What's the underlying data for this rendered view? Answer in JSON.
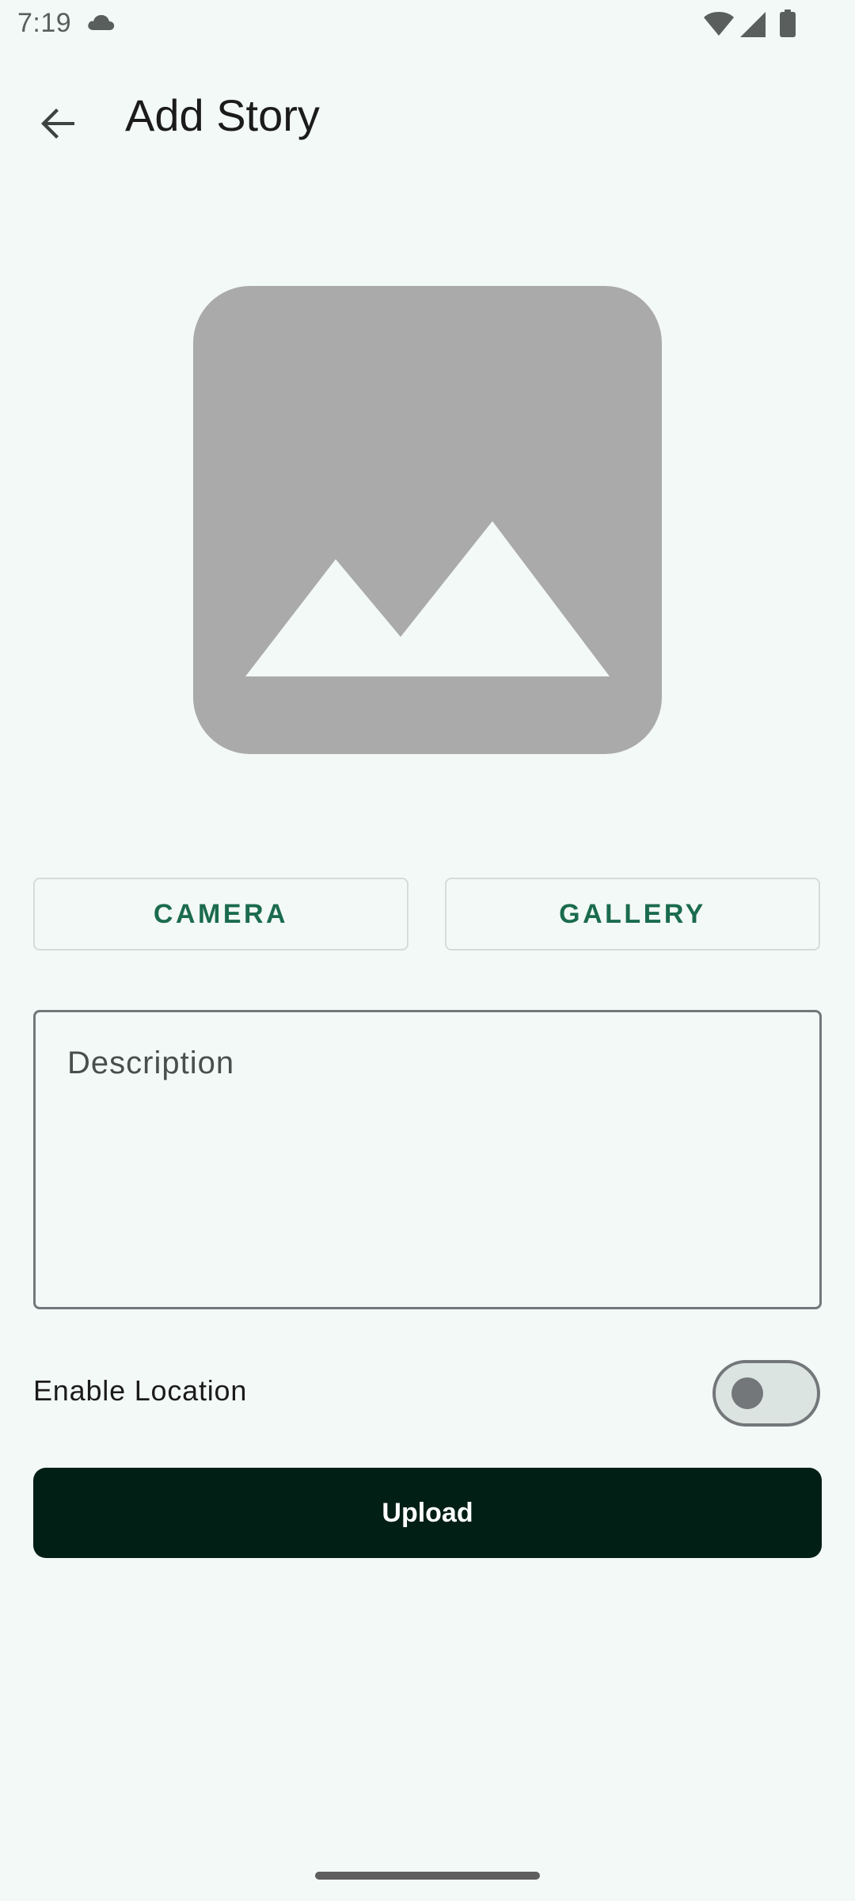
{
  "status_bar": {
    "time": "7:19",
    "icons": [
      "cloud-icon",
      "wifi-icon",
      "signal-icon",
      "battery-icon"
    ]
  },
  "app_bar": {
    "title": "Add Story",
    "back_icon": "arrow-back-icon"
  },
  "image_preview": {
    "icon": "image-placeholder-icon"
  },
  "buttons": {
    "camera_label": "CAMERA",
    "gallery_label": "GALLERY",
    "upload_label": "Upload"
  },
  "description": {
    "placeholder": "Description",
    "value": ""
  },
  "location": {
    "label": "Enable Location",
    "enabled": false
  },
  "colors": {
    "background": "#F3F9F6",
    "accent": "#1B6B4E",
    "upload_button": "#021F16",
    "placeholder_gray": "#AAAAAA"
  }
}
